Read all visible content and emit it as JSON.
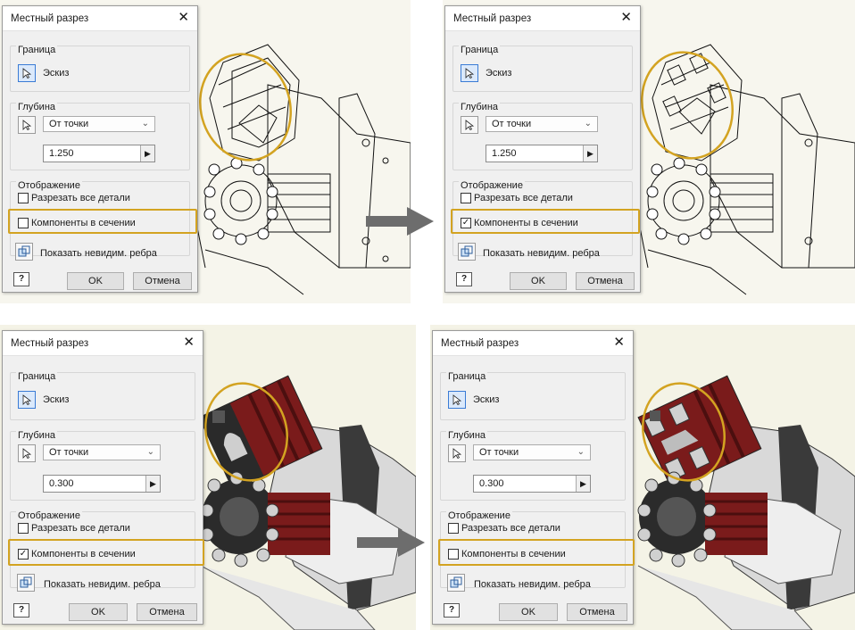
{
  "dialog": {
    "title": "Местный разрез",
    "close_glyph": "✕",
    "boundary_label": "Граница",
    "sketch_label": "Эскиз",
    "depth_label": "Глубина",
    "depth_mode": "От точки",
    "display_label": "Отображение",
    "cut_all_label": "Разрезать все детали",
    "components_label": "Компоненты в сечении",
    "hidden_edges_label": "Показать невидим. ребра",
    "ok_label": "OK",
    "cancel_label": "Отмена",
    "help_glyph": "?"
  },
  "panels": [
    {
      "depth_value": "1.250",
      "components_checked": false,
      "cut_all_checked": false,
      "view": "wireframe"
    },
    {
      "depth_value": "1.250",
      "components_checked": true,
      "cut_all_checked": false,
      "view": "wireframe"
    },
    {
      "depth_value": "0.300",
      "components_checked": true,
      "cut_all_checked": false,
      "view": "shaded"
    },
    {
      "depth_value": "0.300",
      "components_checked": false,
      "cut_all_checked": false,
      "view": "shaded"
    }
  ],
  "ruler_ticks": [
    "5",
    "4"
  ],
  "icons": {
    "close": "close-icon",
    "pick": "cursor-select-icon",
    "dropdown": "chevron-down-icon",
    "next": "arrow-right-icon",
    "hidden_edges": "cube-edges-icon",
    "help": "help-icon",
    "transition": "arrow-right-icon"
  },
  "colors": {
    "highlight": "#d3a321",
    "section_red": "#7a1b1b",
    "arrow": "#6d6d6d"
  }
}
